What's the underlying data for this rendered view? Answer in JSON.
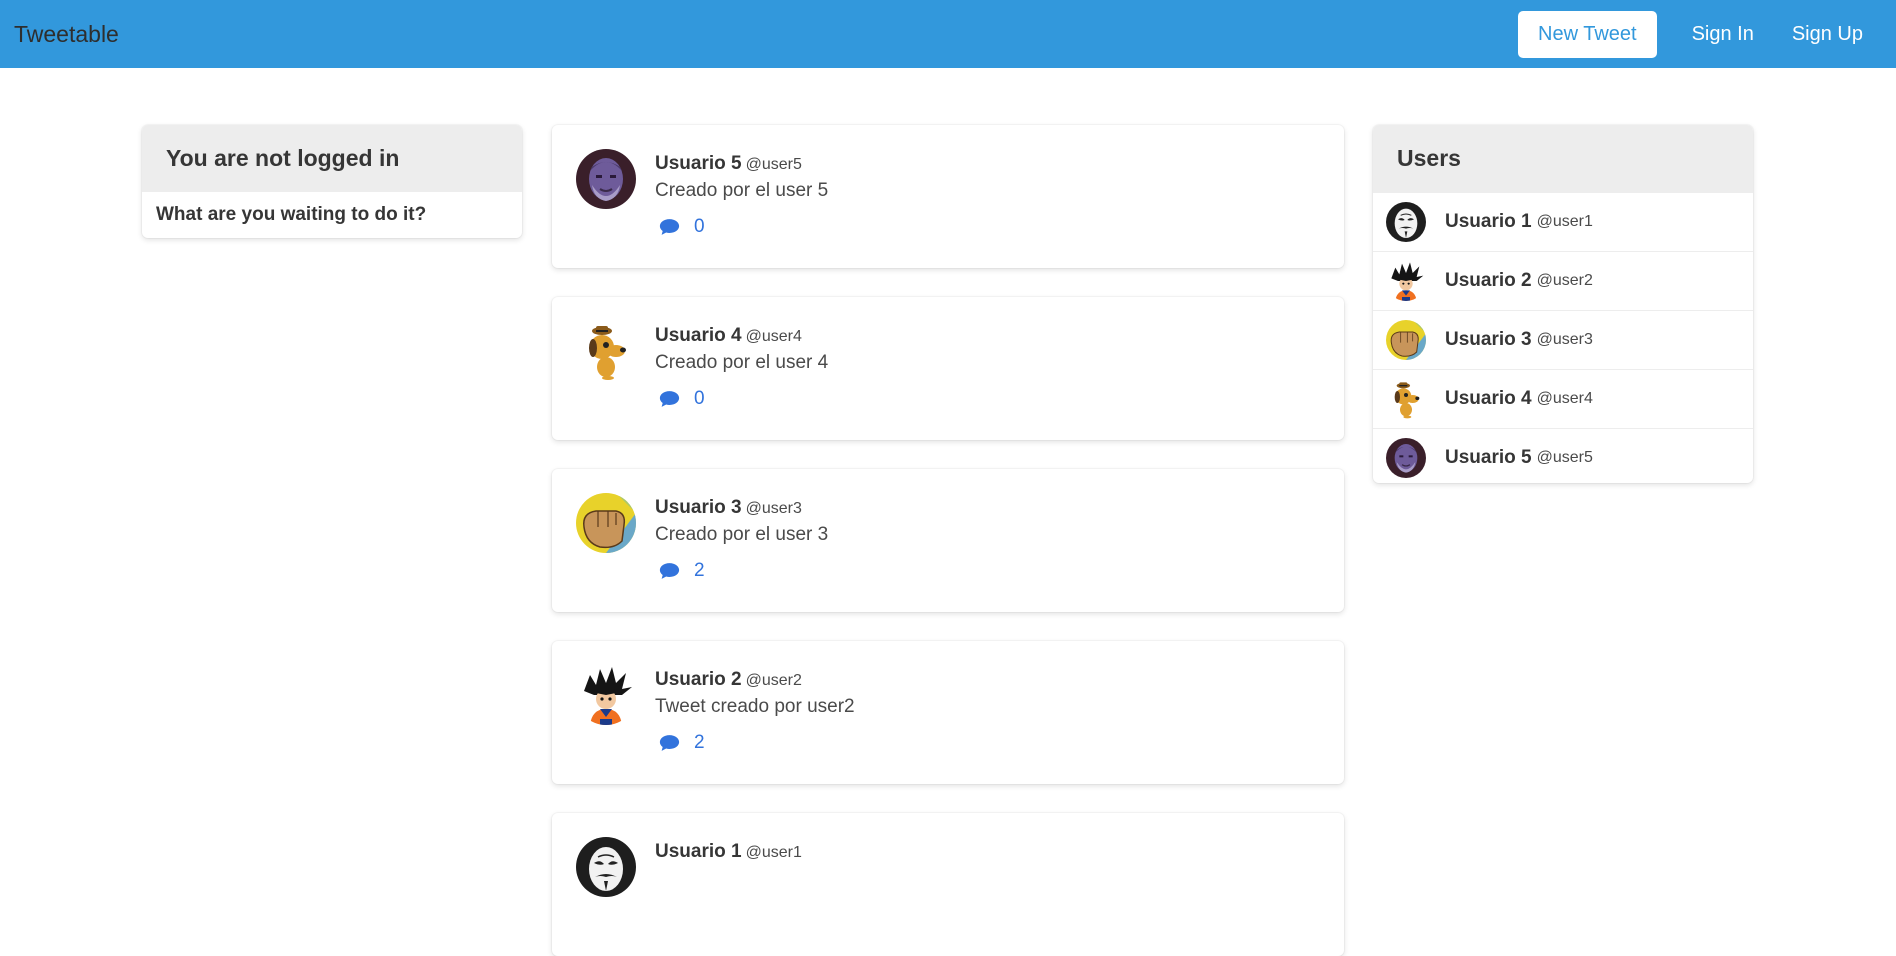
{
  "navbar": {
    "brand": "Tweetable",
    "new_tweet_label": "New Tweet",
    "sign_in_label": "Sign In",
    "sign_up_label": "Sign Up",
    "color": "#3298dc"
  },
  "left_panel": {
    "title": "You are not logged in",
    "message": "What are you waiting to do it?"
  },
  "tweets": [
    {
      "name": "Usuario 5",
      "handle": "@user5",
      "text": "Creado por el user 5",
      "comments": "0",
      "avatar": "thanos-avatar"
    },
    {
      "name": "Usuario 4",
      "handle": "@user4",
      "text": "Creado por el user 4",
      "comments": "0",
      "avatar": "dog-avatar"
    },
    {
      "name": "Usuario 3",
      "handle": "@user3",
      "text": "Creado por el user 3",
      "comments": "2",
      "avatar": "fist-avatar"
    },
    {
      "name": "Usuario 2",
      "handle": "@user2",
      "text": "Tweet creado por user2",
      "comments": "2",
      "avatar": "goku-avatar"
    },
    {
      "name": "Usuario 1",
      "handle": "@user1",
      "text": "",
      "comments": "",
      "avatar": "mask-avatar"
    }
  ],
  "users_panel": {
    "title": "Users",
    "users": [
      {
        "name": "Usuario 1",
        "handle": "@user1",
        "avatar": "mask-avatar"
      },
      {
        "name": "Usuario 2",
        "handle": "@user2",
        "avatar": "goku-avatar"
      },
      {
        "name": "Usuario 3",
        "handle": "@user3",
        "avatar": "fist-avatar"
      },
      {
        "name": "Usuario 4",
        "handle": "@user4",
        "avatar": "dog-avatar"
      },
      {
        "name": "Usuario 5",
        "handle": "@user5",
        "avatar": "thanos-avatar"
      }
    ]
  },
  "colors": {
    "link": "#3273dc",
    "card_header": "#ededed"
  }
}
